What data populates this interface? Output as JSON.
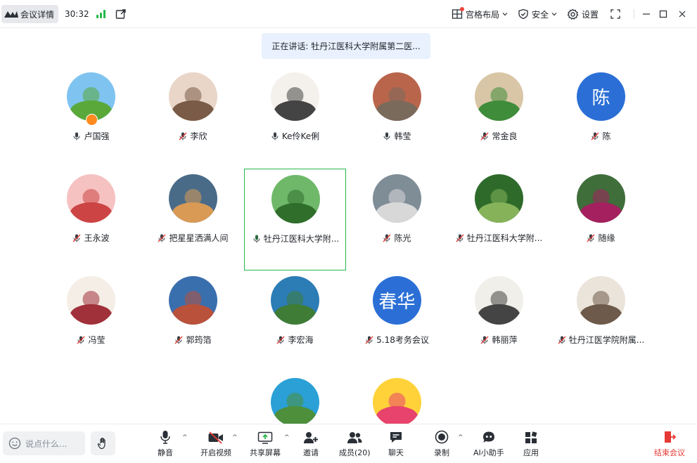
{
  "topbar": {
    "meeting_details": "会议详情",
    "timer": "30:32",
    "grid_layout": "宫格布局",
    "security": "安全",
    "settings": "设置"
  },
  "speaking_banner": "正在讲话: 牡丹江医科大学附属第二医...",
  "participants": [
    {
      "name": "卢国强",
      "muted": false,
      "host": true
    },
    {
      "name": "李欣",
      "muted": true
    },
    {
      "name": "Ke伶Ke俐",
      "muted": false
    },
    {
      "name": "韩莹",
      "muted": false
    },
    {
      "name": "常金良",
      "muted": true
    },
    {
      "name": "陈",
      "muted": true,
      "avatar_text": "陈"
    },
    {
      "name": "王永波",
      "muted": true
    },
    {
      "name": "把星星洒满人间",
      "muted": true
    },
    {
      "name": "牡丹江医科大学附...",
      "muted": false,
      "speaking": true
    },
    {
      "name": "陈光",
      "muted": true
    },
    {
      "name": "牡丹江医科大学附...",
      "muted": true
    },
    {
      "name": "随缘",
      "muted": true
    },
    {
      "name": "冯莹",
      "muted": true
    },
    {
      "name": "郭筠箔",
      "muted": true
    },
    {
      "name": "李宏海",
      "muted": true
    },
    {
      "name": "5.18考务会议",
      "muted": true,
      "avatar_text": "春华"
    },
    {
      "name": "韩丽萍",
      "muted": true
    },
    {
      "name": "牡丹江医学院附属...",
      "muted": true
    },
    {
      "name": "",
      "muted": true
    },
    {
      "name": "",
      "muted": true
    }
  ],
  "bottombar": {
    "chat_placeholder": "说点什么...",
    "mute": "静音",
    "start_video": "开启视频",
    "share_screen": "共享屏幕",
    "invite": "邀请",
    "members": "成员(20)",
    "chat": "聊天",
    "record": "录制",
    "ai_assistant": "AI小助手",
    "apps": "应用",
    "end_meeting": "结束会议"
  },
  "colors": {
    "accent_green": "#24b84a",
    "avatar_blue": "#2b6fd6",
    "end_red": "#e53935",
    "banner_bg": "#e9f1fe"
  }
}
